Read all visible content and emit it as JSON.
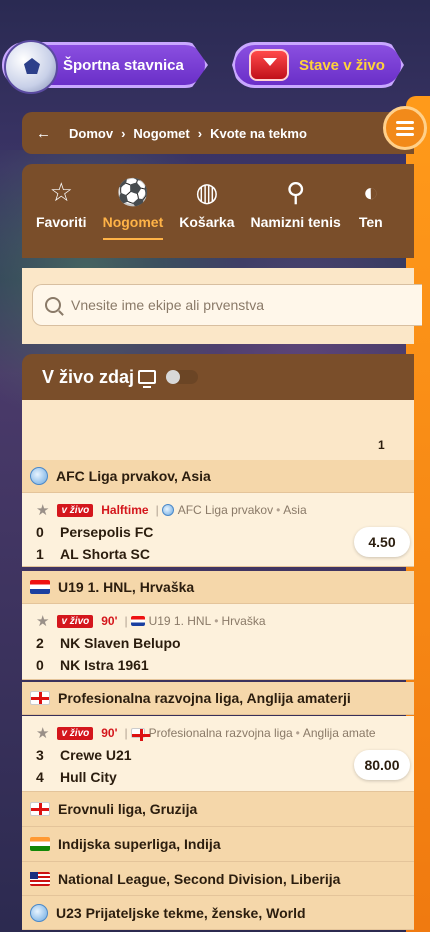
{
  "header": {
    "sport_button": "Športna stavnica",
    "live_button": "Stave v živo"
  },
  "breadcrumb": {
    "items": [
      "Domov",
      "Nogomet",
      "Kvote na tekmo"
    ]
  },
  "sports_tabs": [
    {
      "label": "Favoriti",
      "icon": "star-icon"
    },
    {
      "label": "Nogomet",
      "icon": "football-icon",
      "active": true
    },
    {
      "label": "Košarka",
      "icon": "basketball-icon"
    },
    {
      "label": "Namizni tenis",
      "icon": "table-tennis-icon"
    },
    {
      "label": "Ten",
      "icon": "tennis-icon"
    }
  ],
  "search": {
    "placeholder": "Vnesite ime ekipe ali prvenstva"
  },
  "live": {
    "title": "V živo zdaj",
    "column_header": "1"
  },
  "leagues": [
    {
      "name": "AFC Liga prvakov, Asia",
      "flag": "globe",
      "match": {
        "badge": "v živo",
        "status": "Halftime",
        "competition": "AFC Liga prvakov",
        "region": "Asia",
        "home": {
          "score": "0",
          "name": "Persepolis FC"
        },
        "away": {
          "score": "1",
          "name": "AL Shorta SC"
        },
        "odd": "4.50"
      }
    },
    {
      "name": "U19 1. HNL, Hrvaška",
      "flag": "hr",
      "match": {
        "badge": "v živo",
        "status": "90'",
        "competition": "U19 1. HNL",
        "region": "Hrvaška",
        "home": {
          "score": "2",
          "name": "NK Slaven Belupo"
        },
        "away": {
          "score": "0",
          "name": "NK Istra 1961"
        },
        "odd": ""
      }
    },
    {
      "name": "Profesionalna razvojna liga, Anglija amaterji",
      "flag": "en",
      "match": {
        "badge": "v živo",
        "status": "90'",
        "competition": "Profesionalna razvojna liga",
        "region": "Anglija amate",
        "home": {
          "score": "3",
          "name": "Crewe U21"
        },
        "away": {
          "score": "4",
          "name": "Hull City"
        },
        "odd": "80.00"
      }
    }
  ],
  "collapsed_leagues": [
    {
      "name": "Erovnuli liga, Gruzija",
      "flag": "ge"
    },
    {
      "name": "Indijska superliga, Indija",
      "flag": "in"
    },
    {
      "name": "National League, Second Division, Liberija",
      "flag": "lr"
    },
    {
      "name": "U23 Prijateljske tekme, ženske, World",
      "flag": "globe"
    }
  ]
}
